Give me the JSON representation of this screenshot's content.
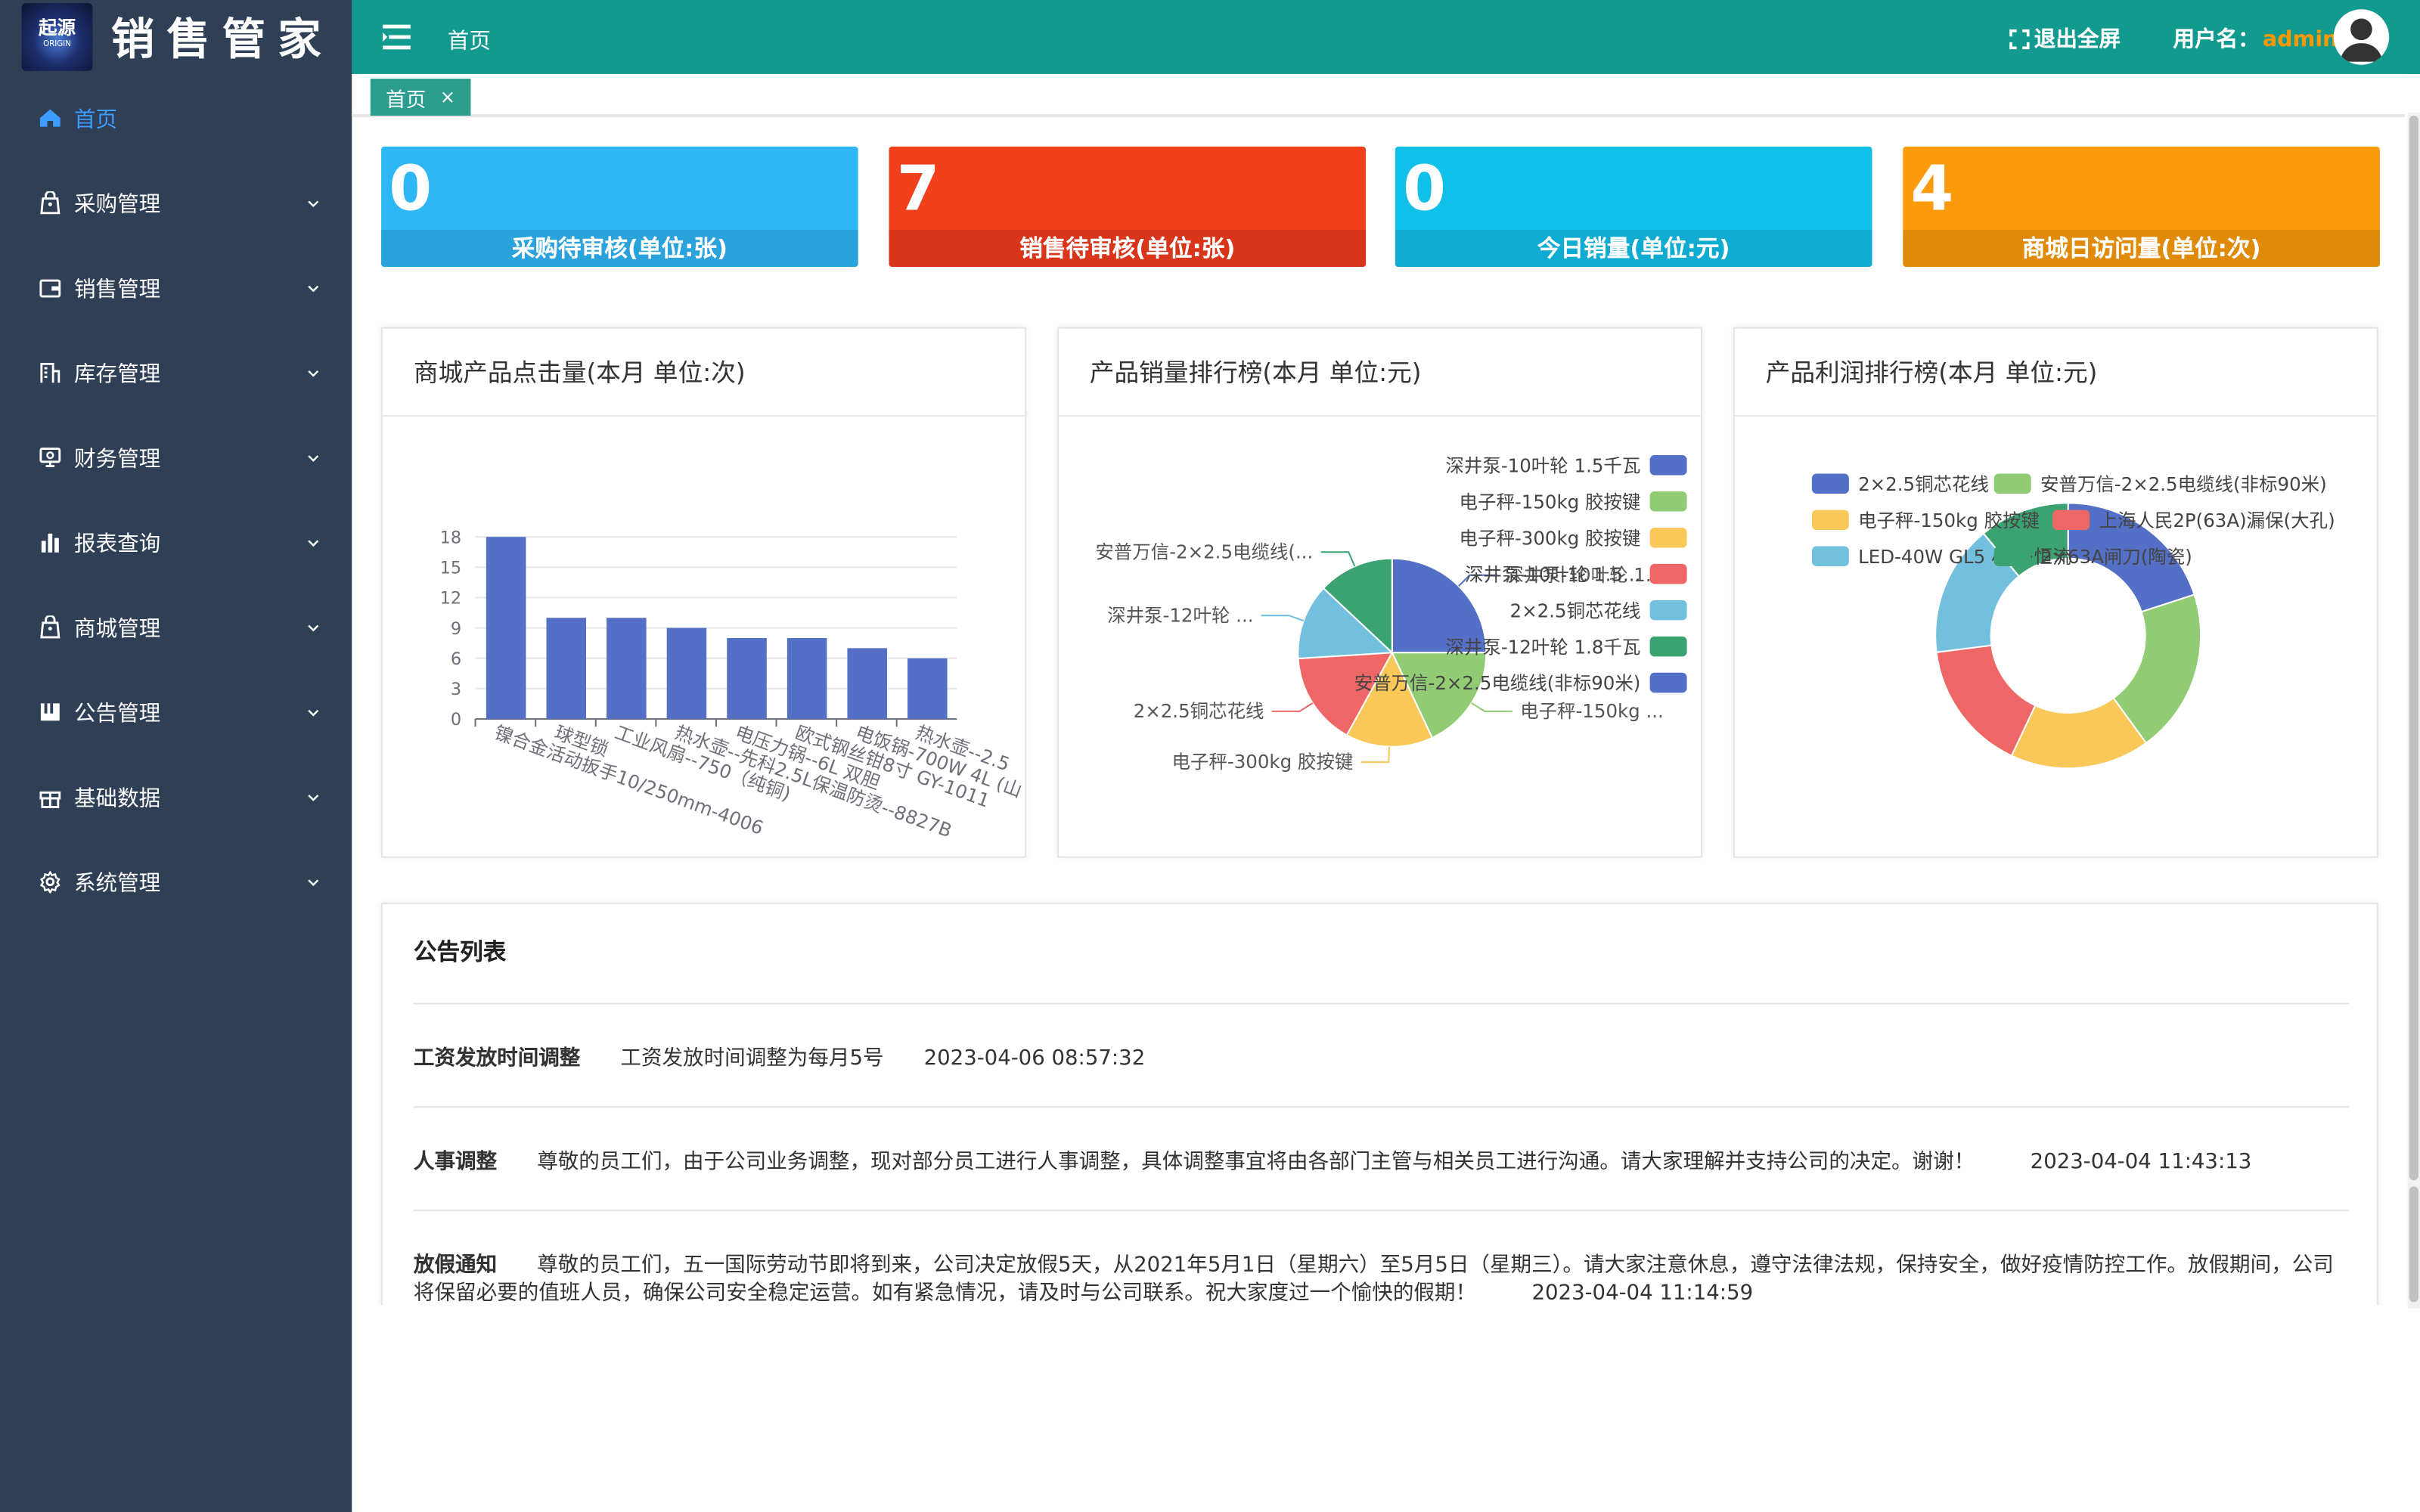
{
  "brand": {
    "logo_text": "起源",
    "logo_sub": "ORIGIN",
    "title": "销售管家"
  },
  "topbar": {
    "breadcrumb": "首页",
    "fullscreen_label": "退出全屏",
    "user_label": "用户名：",
    "user_name": "admin"
  },
  "tabs": [
    {
      "label": "首页",
      "close": "×"
    }
  ],
  "sidebar": {
    "items": [
      {
        "label": "首页",
        "icon": "home-icon",
        "active": true
      },
      {
        "label": "采购管理",
        "icon": "bag-icon"
      },
      {
        "label": "销售管理",
        "icon": "wallet-icon"
      },
      {
        "label": "库存管理",
        "icon": "building-icon"
      },
      {
        "label": "财务管理",
        "icon": "finance-icon"
      },
      {
        "label": "报表查询",
        "icon": "bar-chart-icon"
      },
      {
        "label": "商城管理",
        "icon": "shop-icon"
      },
      {
        "label": "公告管理",
        "icon": "notice-icon"
      },
      {
        "label": "基础数据",
        "icon": "gift-icon"
      },
      {
        "label": "系统管理",
        "icon": "gear-icon"
      }
    ]
  },
  "stats": [
    {
      "value": "0",
      "label": "采购待审核(单位:张)",
      "color": "#2db7f5",
      "band": "#2aa3dc"
    },
    {
      "value": "7",
      "label": "销售待审核(单位:张)",
      "color": "#f2401d",
      "band": "#d9351a"
    },
    {
      "value": "0",
      "label": "今日销量(单位:元)",
      "color": "#11c0e8",
      "band": "#0fabd0"
    },
    {
      "value": "4",
      "label": "商城日访问量(单位:次)",
      "color": "#fc9b0a",
      "band": "#e08a09"
    }
  ],
  "cards": {
    "clicks_title": "商城产品点击量(本月 单位:次)",
    "sales_title": "产品销量排行榜(本月 单位:元)",
    "profit_title": "产品利润排行榜(本月 单位:元)"
  },
  "chart_data": [
    {
      "type": "bar",
      "title": "商城产品点击量(本月 单位:次)",
      "categories": [
        "镍合金活动扳手10/250mm-4006",
        "球型锁",
        "工业风扇--750（纯铜)",
        "热水壶--先科2.5L保温防烫--8827B",
        "电压力锅--6L 双胆",
        "欧式钢丝钳8寸 GY-1011",
        "电饭锅-700W 4L (山",
        "热水壶--2.5"
      ],
      "values": [
        18,
        10,
        10,
        9,
        8,
        8,
        7,
        6
      ],
      "yticks": [
        "0",
        "3",
        "6",
        "9",
        "12",
        "15",
        "18"
      ],
      "ylim": [
        0,
        18
      ],
      "color": "#5470c6",
      "grid": true
    },
    {
      "type": "pie",
      "title": "产品销量排行榜(本月 单位:元)",
      "legend": [
        "深井泵-10叶轮 1.5千瓦",
        "电子秤-150kg  胶按键",
        "电子秤-300kg  胶按键",
        "深井泵-10叶轮 1.5...",
        "2×2.5铜芯花线",
        "深井泵-12叶轮  1.8千瓦",
        "安普万信-2×2.5电缆线(非标90米)"
      ],
      "labels": [
        "深井泵-10叶轮 1.5...",
        "电子秤-150kg  ...",
        "电子秤-300kg  胶按键",
        "2×2.5铜芯花线",
        "深井泵-12叶轮  ...",
        "安普万信-2×2.5电缆线(..."
      ],
      "values": [
        25,
        18,
        15,
        16,
        13,
        13
      ],
      "colors": [
        "#5470c6",
        "#91cc75",
        "#fac858",
        "#ee6666",
        "#73c0de",
        "#3ba272"
      ]
    },
    {
      "type": "pie",
      "title": "产品利润排行榜(本月 单位:元)",
      "legend": [
        "2×2.5铜芯花线",
        "安普万信-2×2.5电缆线(非标90米)",
        "电子秤-150kg  胶按键",
        "上海人民2P(63A)漏保(大孔)",
        "LED-40W GL5 小白·恒流",
        "2×63A闸刀(陶瓷)"
      ],
      "values": [
        20,
        20,
        17,
        16,
        16,
        11
      ],
      "colors": [
        "#5470c6",
        "#91cc75",
        "#fac858",
        "#ee6666",
        "#73c0de",
        "#3ba272"
      ]
    }
  ],
  "notice": {
    "title": "公告列表",
    "rows": [
      {
        "title": "工资发放时间调整",
        "content": "工资发放时间调整为每月5号",
        "date": "2023-04-06 08:57:32"
      },
      {
        "title": "人事调整",
        "content": "尊敬的员工们，由于公司业务调整，现对部分员工进行人事调整，具体调整事宜将由各部门主管与相关员工进行沟通。请大家理解并支持公司的决定。谢谢！",
        "date": "2023-04-04 11:43:13"
      },
      {
        "title": "放假通知",
        "content": "尊敬的员工们，五一国际劳动节即将到来，公司决定放假5天，从2021年5月1日（星期六）至5月5日（星期三）。请大家注意休息，遵守法律法规，保持安全，做好疫情防控工作。放假期间，公司将保留必要的值班人员，确保公司安全稳定运营。如有紧急情况，请及时与公司联系。祝大家度过一个愉快的假期！",
        "date": "2023-04-04 11:14:59"
      }
    ]
  }
}
